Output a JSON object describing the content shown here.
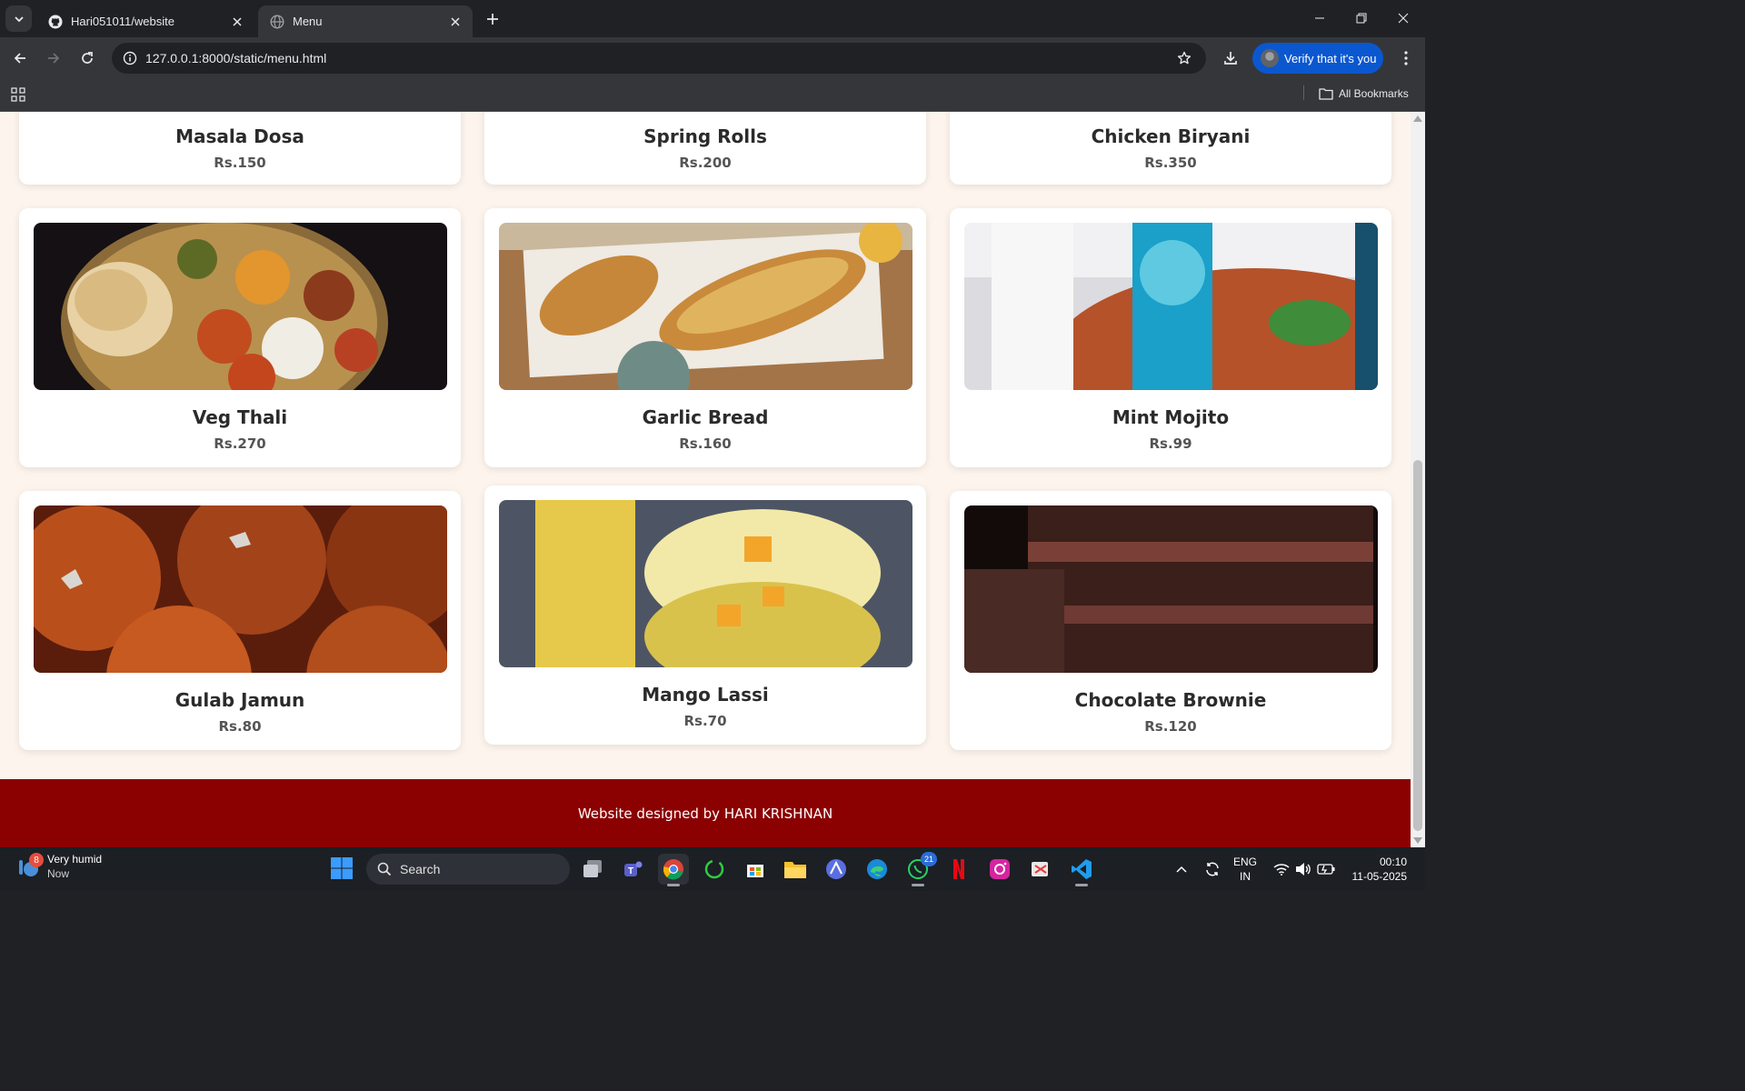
{
  "browser": {
    "tabs": [
      {
        "title": "Hari051011/website",
        "icon": "github-icon",
        "active": false
      },
      {
        "title": "Menu",
        "icon": "globe-icon",
        "active": true
      }
    ],
    "url": "127.0.0.1:8000/static/menu.html",
    "verify_label": "Verify that it's you",
    "bookmarks_label": "All Bookmarks"
  },
  "menu": {
    "items": [
      {
        "name": "Masala Dosa",
        "price": "Rs.150"
      },
      {
        "name": "Spring Rolls",
        "price": "Rs.200"
      },
      {
        "name": "Chicken Biryani",
        "price": "Rs.350"
      },
      {
        "name": "Veg Thali",
        "price": "Rs.270",
        "image": "veg-thali-photo"
      },
      {
        "name": "Garlic Bread",
        "price": "Rs.160",
        "image": "garlic-bread-photo"
      },
      {
        "name": "Mint Mojito",
        "price": "Rs.99",
        "image": "mint-mojito-photo"
      },
      {
        "name": "Gulab Jamun",
        "price": "Rs.80",
        "image": "gulab-jamun-photo"
      },
      {
        "name": "Mango Lassi",
        "price": "Rs.70",
        "image": "mango-lassi-photo"
      },
      {
        "name": "Chocolate Brownie",
        "price": "Rs.120",
        "image": "chocolate-brownie-photo"
      }
    ],
    "footer": "Website designed by HARI KRISHNAN"
  },
  "taskbar": {
    "weather_title": "Very humid",
    "weather_sub": "Now",
    "weather_badge": "8",
    "search_label": "Search",
    "whatsapp_badge": "21",
    "lang_top": "ENG",
    "lang_bottom": "IN",
    "time": "00:10",
    "date": "11-05-2025"
  },
  "colors": {
    "page_bg": "#fdf5ed",
    "footer_bg": "#8b0000",
    "accent": "#0b57d0"
  }
}
